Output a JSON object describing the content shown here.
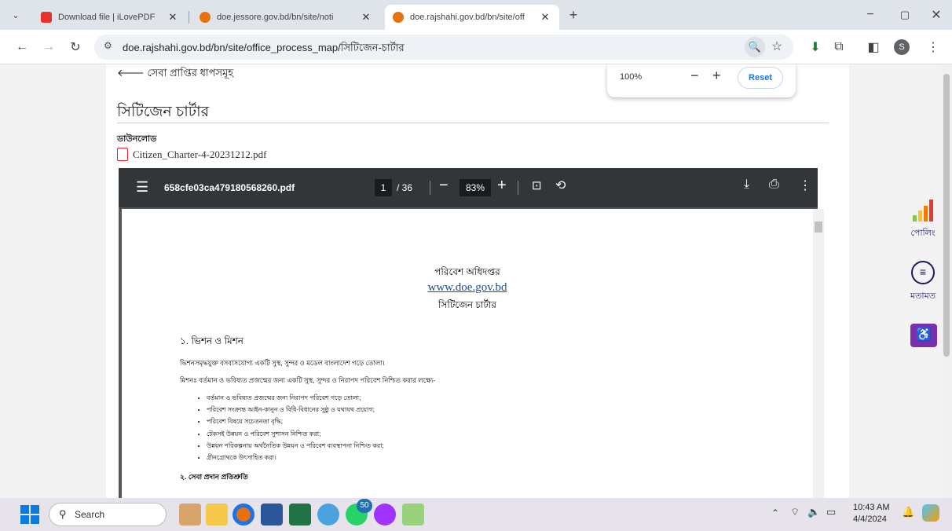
{
  "browser": {
    "tabs": [
      {
        "title": "Download file | iLovePDF",
        "fav_color": "#e5322d",
        "active": false
      },
      {
        "title": "doe.jessore.gov.bd/bn/site/noti",
        "fav_color": "#e8710a",
        "active": false
      },
      {
        "title": "doe.rajshahi.gov.bd/bn/site/off",
        "fav_color": "#e8710a",
        "active": true
      }
    ],
    "url": "doe.rajshahi.gov.bd/bn/site/office_process_map/সিটিজেন-চার্টার",
    "zoom_popup": {
      "value": "100%",
      "minus": "−",
      "plus": "+",
      "reset": "Reset"
    }
  },
  "page": {
    "back_link": "সেবা প্রাপ্তির ধাপসমূহ",
    "heading": "সিটিজেন চার্টার",
    "download_label": "ডাউনলোড",
    "file_name": "Citizen_Charter-4-20231212.pdf"
  },
  "pdf": {
    "file_title": "658cfe03ca479180568260.pdf",
    "current_page": "1",
    "total_pages": "/ 36",
    "zoom": "83%",
    "doc": {
      "org": "পরিবেশ অধিদপ্তর",
      "website": "www.doe.gov.bd",
      "title": "সিটিজেন চার্টার",
      "section1": "১. ভিশন ও মিশন",
      "vision": "ভিশনসমৃদ্ধযুক্ত বসবাসযোগ্য একটি সুস্থ, সুন্দর ও মডেল বাংলাদেশ গড়ে তোলা।",
      "mission": "মিশনঃ বর্তমান ও ভবিষ্যত প্রজন্মের জন্য একটি সুস্থ, সুন্দর ও নিরাপদ পরিবেশ নিশ্চিত করার লক্ষ্যে-",
      "bullets": [
        "বর্তমান ও ভবিষ্যত প্রজন্মের জন্য নিরাপদ পরিবেশ গড়ে তোলা;",
        "পরিবেশ সংক্রান্ত আইন-কানুন ও বিধি-বিধানের সুষ্ঠু ও যথাযথ প্রয়োগ;",
        "পরিবেশ বিষয়ে সচেতনতা বৃদ্ধি;",
        "টেকসই উন্নয়ন ও পরিবেশ সুশাসন নিশ্চিত করা;",
        "উন্নয়ন পরিকল্পনায় অর্থনৈতিক উন্নয়ন ও পরিবেশ ব্যবস্থাপনা নিশ্চিত করা;",
        "গ্রীনগ্রোথকে উৎসাহিত করা।"
      ],
      "section2": "২. সেবা প্রদান প্রতিশ্রুতি"
    }
  },
  "side": {
    "poll_label": "পোলিং",
    "feedback_label": "মতামত"
  },
  "taskbar": {
    "search_placeholder": "Search",
    "time": "10:43 AM",
    "date": "4/4/2024",
    "whatsapp_badge": "50"
  }
}
